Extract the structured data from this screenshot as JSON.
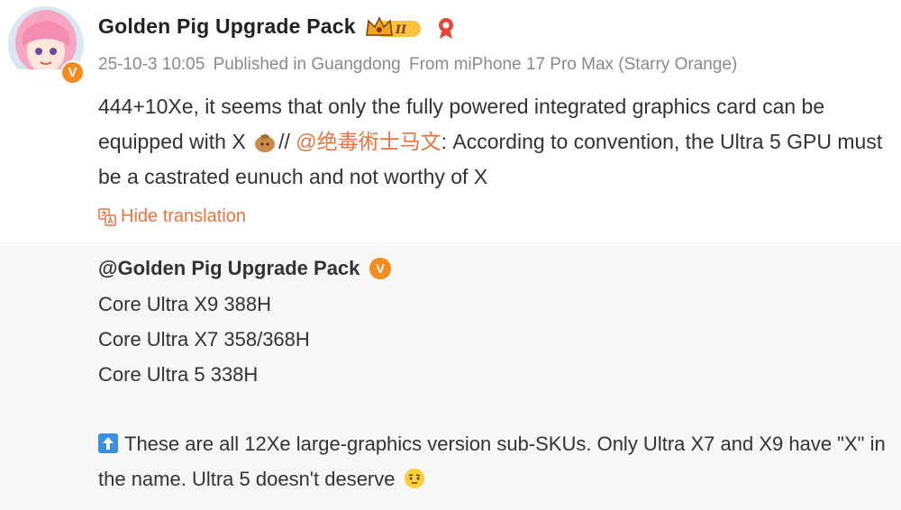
{
  "post": {
    "author": "Golden Pig Upgrade Pack",
    "verified_mark": "V",
    "level_badge": "II",
    "meta": {
      "timestamp": "25-10-3 10:05",
      "location": "Published in Guangdong",
      "device": "From miPhone 17 Pro Max (Starry Orange)"
    },
    "text_before_emoji": "444+10Xe, it seems that only the fully powered integrated graphics card can be equipped with X ",
    "text_after_emoji": "// ",
    "mention": "@绝毒術士马文",
    "text_after_mention": ": According to convention, the Ultra 5 GPU must be a castrated eunuch and not worthy of X",
    "hide_translation": "Hide translation"
  },
  "repost": {
    "author": "@Golden Pig Upgrade Pack",
    "verified_mark": "V",
    "lines": [
      "Core Ultra X9 388H",
      "Core Ultra X7 358/368H",
      "Core Ultra 5 338H"
    ],
    "note": "These are all 12Xe large-graphics version sub-SKUs. Only Ultra X7 and X9 have \"X\" in the name. Ultra 5 doesn't deserve "
  },
  "icons": {
    "avatar": "anime-avatar",
    "verified": "verified-icon",
    "crown": "crown-badge-icon",
    "extra": "fire-icon",
    "translate": "translate-icon",
    "up_arrow": "up-arrow-icon",
    "emoji_1": "emoji-pouch",
    "emoji_2": "emoji-thinking"
  },
  "colors": {
    "accent": "#eb7340",
    "verified": "#f48b1e",
    "meta_text": "#8a8a8a",
    "repost_bg": "#f7f7f7"
  }
}
